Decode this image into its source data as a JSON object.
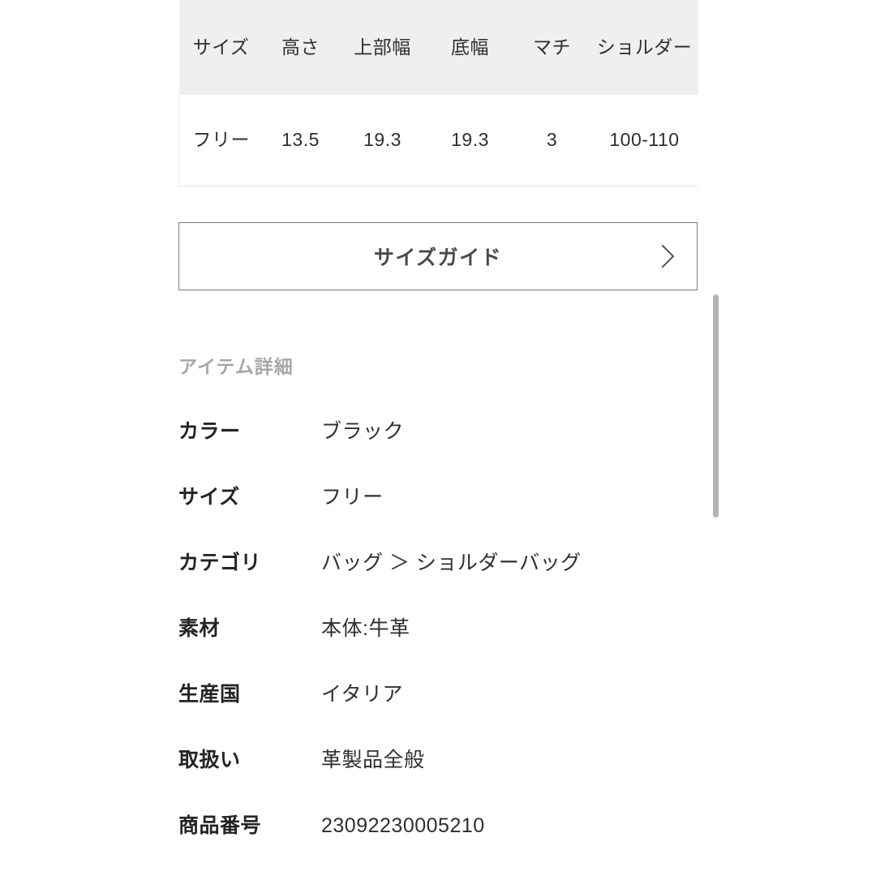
{
  "size_table": {
    "headers": [
      "サイズ",
      "高さ",
      "上部幅",
      "底幅",
      "マチ",
      "ショルダー"
    ],
    "rows": [
      [
        "フリー",
        "13.5",
        "19.3",
        "19.3",
        "3",
        "100-110"
      ]
    ],
    "header_bg": "#efefef",
    "text_color": "#2f2f2f"
  },
  "size_guide_button": {
    "label": "サイズガイド",
    "chevron_icon": "chevron-right-icon",
    "border_color": "#7b7b7b"
  },
  "item_details": {
    "heading": "アイテム詳細",
    "heading_color": "#a7a7a7",
    "rows": [
      {
        "label": "カラー",
        "value": "ブラック"
      },
      {
        "label": "サイズ",
        "value": "フリー"
      },
      {
        "label": "カテゴリ",
        "value": "バッグ ＞ ショルダーバッグ"
      },
      {
        "label": "素材",
        "value": "本体:牛革"
      },
      {
        "label": "生産国",
        "value": "イタリア"
      },
      {
        "label": "取扱い",
        "value": "革製品全般"
      },
      {
        "label": "商品番号",
        "value": "23092230005210"
      }
    ]
  },
  "scrollbar": {
    "thumb_color": "#b3b3b3"
  }
}
